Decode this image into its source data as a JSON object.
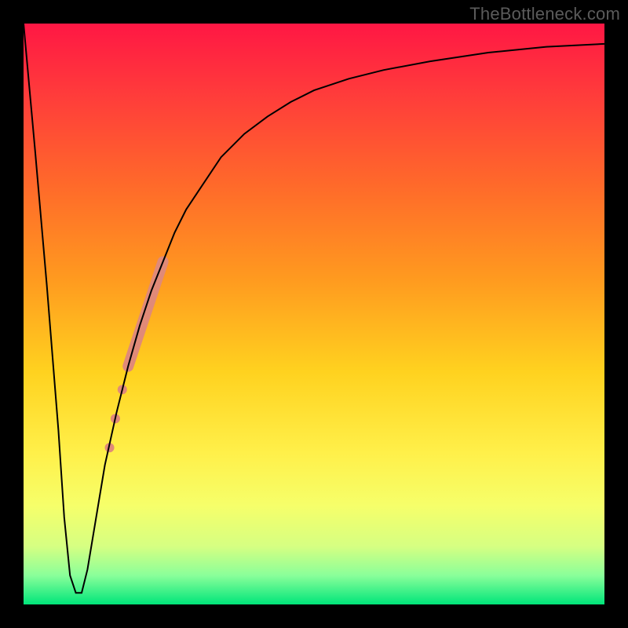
{
  "watermark": "TheBottleneck.com",
  "chart_data": {
    "type": "line",
    "title": "",
    "xlabel": "",
    "ylabel": "",
    "xlim": [
      0,
      100
    ],
    "ylim": [
      0,
      100
    ],
    "grid": false,
    "legend": false,
    "background": {
      "type": "vertical-gradient",
      "stops": [
        {
          "pos": 0.0,
          "color": "#ff1744"
        },
        {
          "pos": 0.12,
          "color": "#ff3b3b"
        },
        {
          "pos": 0.28,
          "color": "#ff6a2a"
        },
        {
          "pos": 0.44,
          "color": "#ff9a1f"
        },
        {
          "pos": 0.6,
          "color": "#ffd21f"
        },
        {
          "pos": 0.74,
          "color": "#fff04a"
        },
        {
          "pos": 0.83,
          "color": "#f6ff6a"
        },
        {
          "pos": 0.9,
          "color": "#d6ff82"
        },
        {
          "pos": 0.95,
          "color": "#8aff9a"
        },
        {
          "pos": 1.0,
          "color": "#00e57a"
        }
      ]
    },
    "series": [
      {
        "name": "curve",
        "color": "#000000",
        "stroke_width": 2,
        "x": [
          0,
          2,
          4,
          6,
          7,
          8,
          9,
          10,
          11,
          12,
          14,
          16,
          18,
          20,
          22,
          24,
          26,
          28,
          30,
          34,
          38,
          42,
          46,
          50,
          56,
          62,
          70,
          80,
          90,
          100
        ],
        "y": [
          100,
          78,
          55,
          30,
          15,
          5,
          2,
          2,
          6,
          12,
          24,
          33,
          41,
          48,
          54,
          59,
          64,
          68,
          71,
          77,
          81,
          84,
          86.5,
          88.5,
          90.5,
          92,
          93.5,
          95,
          96,
          96.5
        ]
      }
    ],
    "markers": {
      "name": "highlighted-segment",
      "color": "#e08a78",
      "shape": "circle",
      "thick_segment": {
        "x1": 18,
        "y1": 41,
        "x2": 24,
        "y2": 59,
        "width": 14
      },
      "dots": [
        {
          "x": 17.0,
          "y": 37,
          "r": 6
        },
        {
          "x": 15.8,
          "y": 32,
          "r": 6
        },
        {
          "x": 14.8,
          "y": 27,
          "r": 6
        }
      ]
    }
  }
}
